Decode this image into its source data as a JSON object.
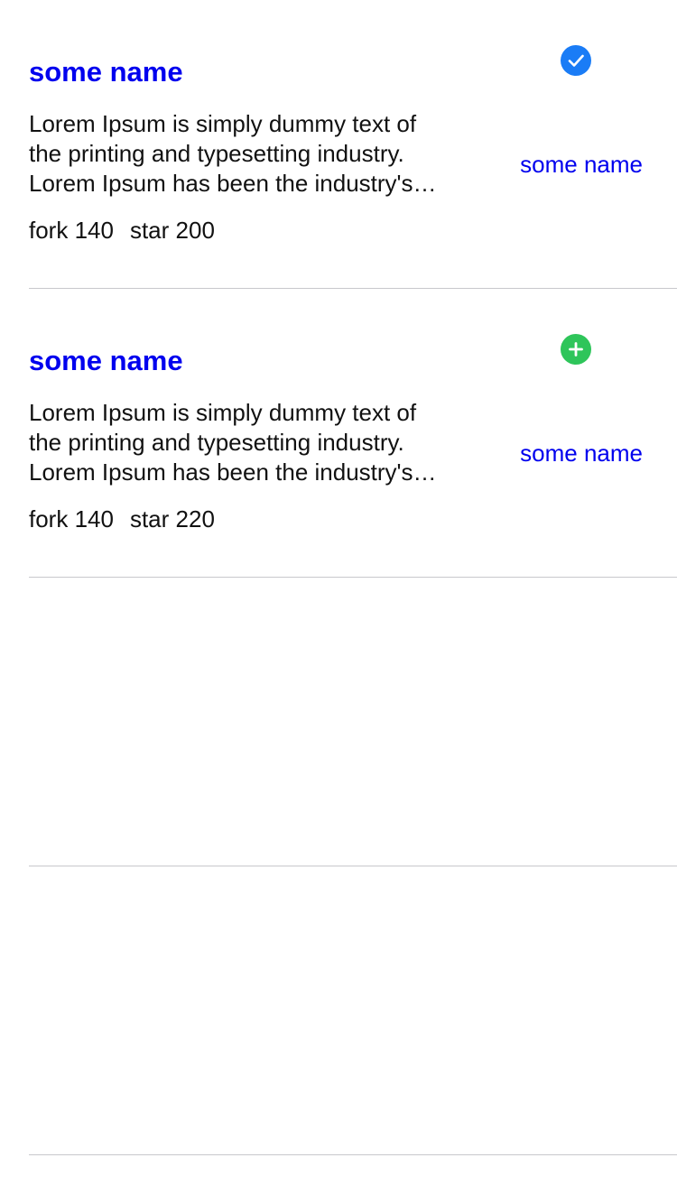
{
  "repos": [
    {
      "name": "some name",
      "description": "Lorem Ipsum is simply dummy text of the printing and typesetting industry. Lorem Ipsum has been the industry's standard dummy text",
      "fork_label": "fork 140",
      "star_label": "star 200",
      "status_icon": "checkmark-circle-icon",
      "status_color": "#1a7cf6",
      "owner": "some name"
    },
    {
      "name": "some name",
      "description": "Lorem Ipsum is simply dummy text of the printing and typesetting industry. Lorem Ipsum has been the industry's standard dummy text",
      "fork_label": "fork 140",
      "star_label": "star 220",
      "status_icon": "plus-circle-icon",
      "status_color": "#2ec55a",
      "owner": "some name"
    }
  ],
  "colors": {
    "link": "#0000ee",
    "text": "#111111",
    "separator": "#c8c8cc"
  }
}
